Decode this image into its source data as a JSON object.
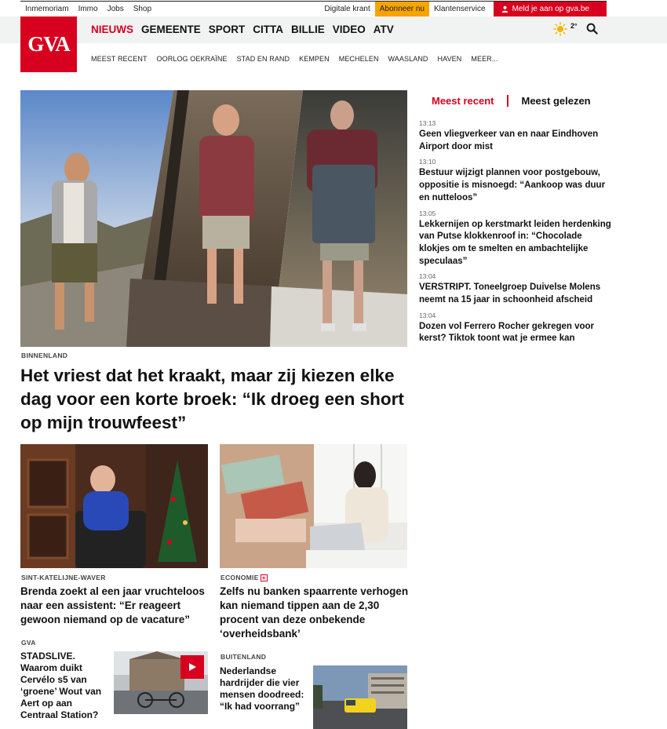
{
  "topbar": {
    "left_links": [
      "Inmemoriam",
      "Immo",
      "Jobs",
      "Shop"
    ],
    "digital": "Digitale krant",
    "subscribe": "Abonneer nu",
    "service": "Klantenservice",
    "login": "Meld je aan op gva.be"
  },
  "header": {
    "logo": "GVA",
    "nav": [
      "NIEUWS",
      "GEMEENTE",
      "SPORT",
      "CITTA",
      "BILLIE",
      "VIDEO",
      "ATV"
    ],
    "weather_temp": "2°",
    "subnav": [
      "MEEST RECENT",
      "OORLOG OEKRAÏNE",
      "STAD EN RAND",
      "KEMPEN",
      "MECHELEN",
      "WAASLAND",
      "HAVEN",
      "MEER..."
    ]
  },
  "hero": {
    "kicker": "BINNENLAND",
    "title": "Het vriest dat het kraakt, maar zij kiezen elke dag voor een korte broek: “Ik droeg een short op mijn trouwfeest”"
  },
  "cards": [
    {
      "kicker": "SINT-KATELIJNE-WAVER",
      "title": "Brenda zoekt al een jaar vruchteloos naar een assistent: “Er reageert gewoon niemand op de vacature”"
    },
    {
      "kicker": "ECONOMIE",
      "badge": "+",
      "title": "Zelfs nu banken spaarrente verhogen kan niemand tippen aan de 2,30 procent van deze onbekende ‘overheidsbank’"
    }
  ],
  "small_cards": [
    {
      "kicker": "GVA",
      "title": "STADSLIVE. Waarom duikt Cervélo s5 van ‘groene’ Wout van Aert op aan Centraal Station?"
    },
    {
      "kicker": "BUITENLAND",
      "title": "Nederlandse hardrijder die vier mensen doodreed: “Ik had voorrang”"
    }
  ],
  "sidebar": {
    "tab_recent": "Meest recent",
    "tab_read": "Meest gelezen",
    "items": [
      {
        "time": "13:13",
        "text": "Geen vliegverkeer van en naar Eindhoven Airport door mist"
      },
      {
        "time": "13:10",
        "text": "Bestuur wijzigt plannen voor postgebouw, oppositie is misnoegd: “Aankoop was duur en nutteloos”"
      },
      {
        "time": "13:05",
        "text": "Lekkernijen op kerstmarkt leiden herdenking van Putse klokkenroof in: “Chocolade klokjes om te smelten en ambachtelijke speculaas”"
      },
      {
        "time": "13:04",
        "text": "VERSTRIPT. Toneelgroep Duivelse Molens neemt na 15 jaar in schoonheid afscheid"
      },
      {
        "time": "13:04",
        "text": "Dozen vol Ferrero Rocher gekregen voor kerst? Tiktok toont wat je ermee kan"
      }
    ]
  },
  "colors": {
    "brand_red": "#d8001f",
    "subscribe_orange": "#f7a400",
    "header_band": "#f1f3f3"
  }
}
